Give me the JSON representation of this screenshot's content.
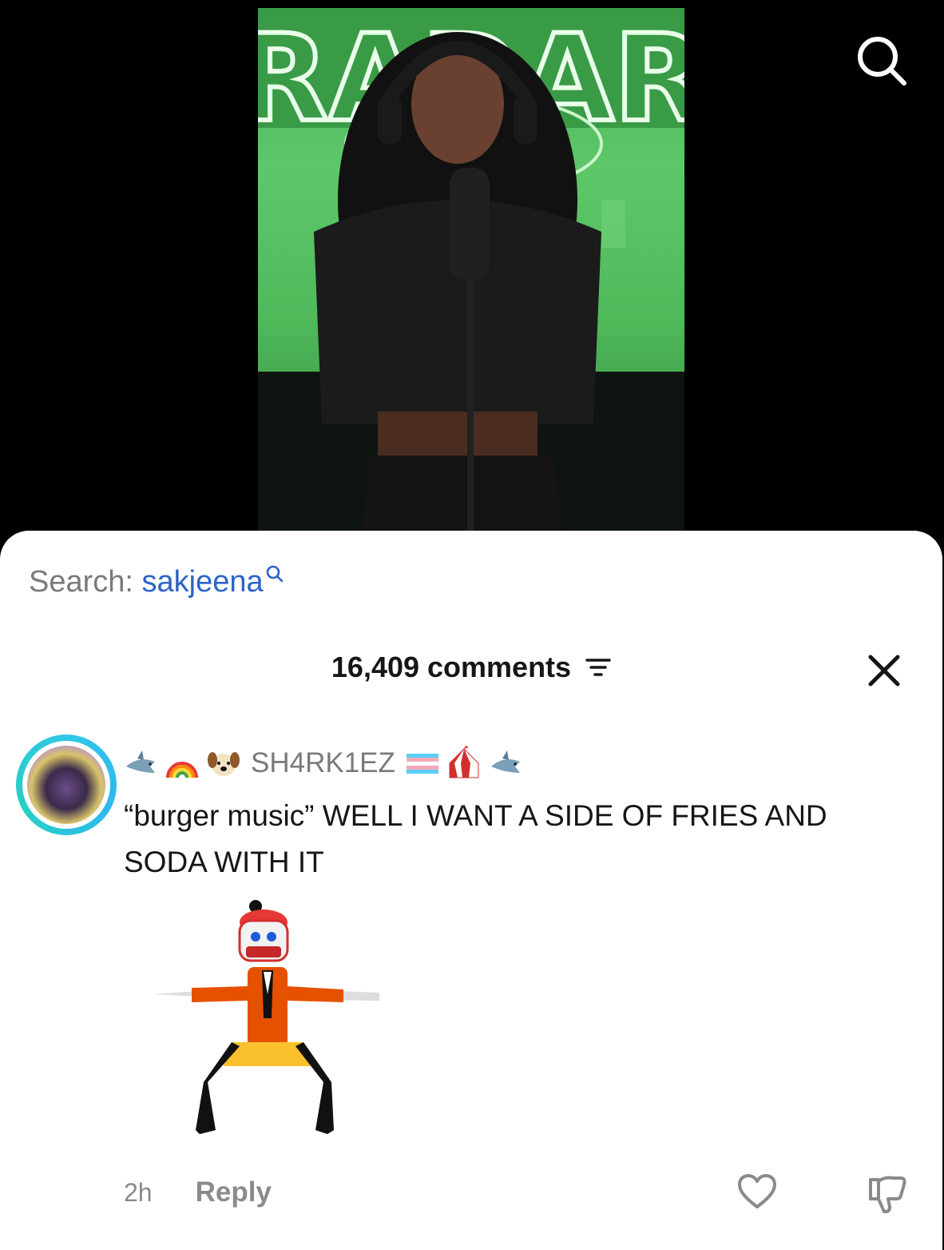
{
  "video": {
    "sign_text": "RADAR"
  },
  "sheet": {
    "search_prefix": "Search:",
    "search_term": "sakjeena",
    "comments_count": "16,409 comments"
  },
  "comment": {
    "username": "SH4RK1EZ",
    "emojis_before": [
      "shark-emoji",
      "rainbow-emoji",
      "dog-face-emoji"
    ],
    "emojis_after": [
      "transgender-flag-emoji",
      "circus-tent-emoji",
      "shark-emoji"
    ],
    "text": "“burger music” WELL I WANT A SIDE OF FRIES AND SODA WITH IT",
    "time": "2h",
    "reply_label": "Reply"
  },
  "colors": {
    "search_term": "#2d63c8",
    "avatar_ring": "#2fc7e6",
    "green_backdrop": "#4fb95a"
  },
  "icons": {
    "top_search": "search-icon",
    "filter": "filter-icon",
    "close": "close-icon",
    "like": "heart-icon",
    "dislike": "thumbs-down-icon"
  }
}
